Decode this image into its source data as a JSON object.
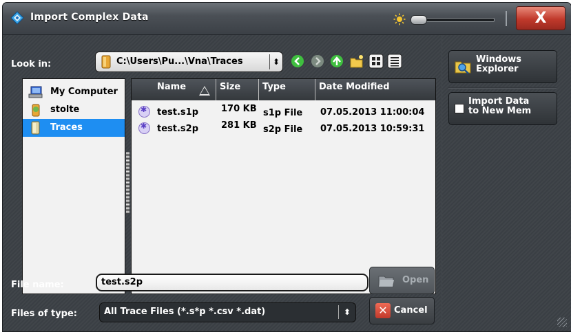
{
  "window": {
    "title": "Import Complex Data",
    "close_label": "X"
  },
  "look_in": {
    "label": "Look in:",
    "path": "C:\\Users\\Pu...\\Vna\\Traces",
    "spin": "⬍"
  },
  "toolbar": {
    "back_icon": "back-arrow-icon",
    "forward_icon": "forward-arrow-icon",
    "up_icon": "up-folder-icon",
    "new_folder_icon": "new-folder-icon",
    "icon_view_icon": "icon-view-icon",
    "list_view_icon": "list-view-icon"
  },
  "places": [
    {
      "label": "My Computer",
      "icon": "computer-icon",
      "selected": false
    },
    {
      "label": "stolte",
      "icon": "user-icon",
      "selected": false
    },
    {
      "label": "Traces",
      "icon": "folder-icon",
      "selected": true
    }
  ],
  "columns": {
    "name": "Name",
    "size": "Size",
    "type": "Type",
    "date": "Date Modified"
  },
  "files": [
    {
      "name": "test.s1p",
      "size": "170 KB",
      "type": "s1p File",
      "date": "07.05.2013 11:00:04"
    },
    {
      "name": "test.s2p",
      "size": "281 KB",
      "type": "s2p File",
      "date": "07.05.2013 10:59:31"
    }
  ],
  "file_name": {
    "label": "File name:",
    "value": "test.s2p"
  },
  "file_type": {
    "label": "Files of type:",
    "value": "All Trace Files (*.s*p *.csv *.dat)",
    "spin": "⬍"
  },
  "buttons": {
    "open": "Open",
    "cancel": "Cancel"
  },
  "side": {
    "windows_explorer_line1": "Windows",
    "windows_explorer_line2": "Explorer",
    "import_line1": "Import Data",
    "import_line2": "to New Mem"
  },
  "colors": {
    "selection": "#1e8ef2",
    "panel_bg": "#3c4146",
    "list_bg": "#f2f2f2",
    "close_red": "#c0392b"
  }
}
